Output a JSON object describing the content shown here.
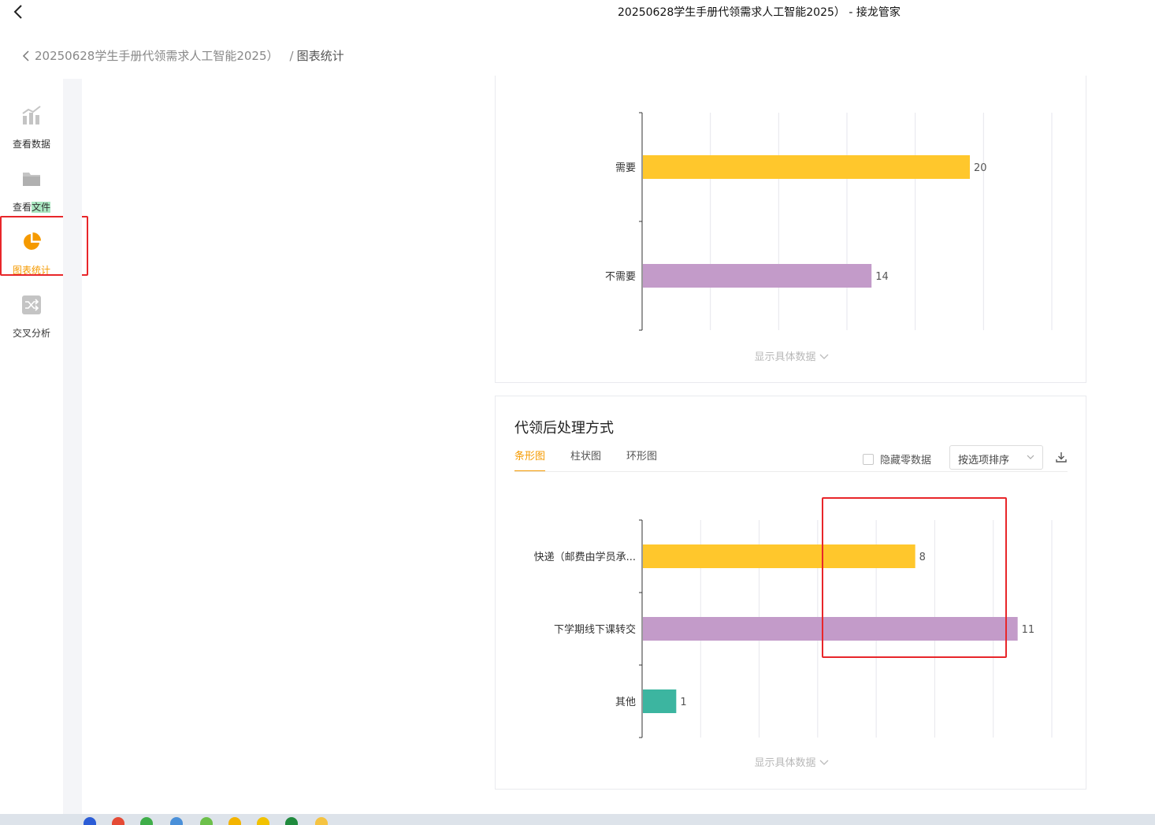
{
  "window": {
    "title": "20250628学生手册代领需求人工智能2025） - 接龙管家"
  },
  "breadcrumb": {
    "parent": "20250628学生手册代领需求人工智能2025）",
    "separator": "/",
    "current": "图表统计"
  },
  "sidebar": {
    "items": [
      {
        "label": "查看数据",
        "icon": "bar-trend-icon"
      },
      {
        "label_a": "查看",
        "label_b": "文件",
        "icon": "folder-icon"
      },
      {
        "label": "图表统计",
        "icon": "pie-chart-icon",
        "active": true
      },
      {
        "label": "交叉分析",
        "icon": "shuffle-icon"
      }
    ]
  },
  "colors": {
    "accent": "#f59a00",
    "bar1": "#ffc72c",
    "bar2": "#c39bc9",
    "bar3": "#3cb5a0",
    "annotation": "#e8262a"
  },
  "card1": {
    "show_detail": "显示具体数据"
  },
  "card2": {
    "title": "代领后处理方式",
    "tabs": [
      "条形图",
      "柱状图",
      "环形图"
    ],
    "active_tab": 0,
    "hide_zero": "隐藏零数据",
    "sort_select": "按选项排序",
    "download_icon": "download-icon",
    "show_detail": "显示具体数据"
  },
  "chart_data": [
    {
      "type": "bar",
      "orientation": "horizontal",
      "categories": [
        "需要",
        "不需要"
      ],
      "values": [
        20,
        14
      ],
      "value_labels": [
        "20",
        "14"
      ],
      "xlim": [
        0,
        25
      ],
      "grid": true,
      "colors": [
        "#ffc72c",
        "#c39bc9"
      ]
    },
    {
      "type": "bar",
      "orientation": "horizontal",
      "categories": [
        "快递（邮费由学员承...",
        "下学期线下课转交",
        "其他"
      ],
      "values": [
        8,
        11,
        1
      ],
      "value_labels": [
        "8",
        "11",
        "1"
      ],
      "xlim": [
        0,
        12
      ],
      "grid": true,
      "colors": [
        "#ffc72c",
        "#c39bc9",
        "#3cb5a0"
      ]
    }
  ]
}
